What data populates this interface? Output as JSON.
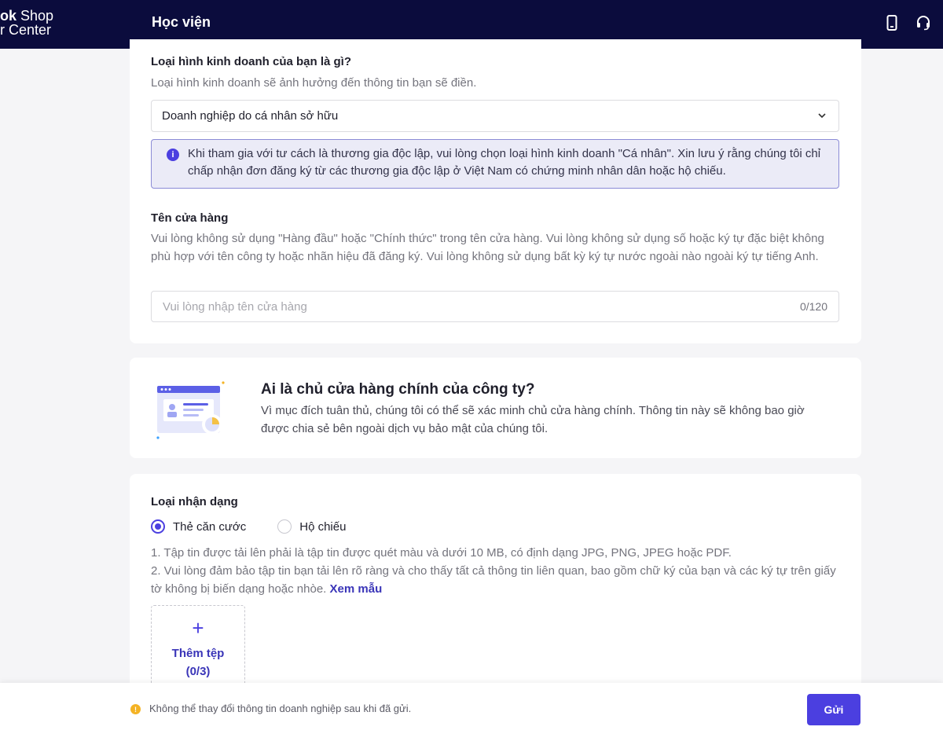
{
  "header": {
    "brand_line1_bold": "ok",
    "brand_line1_rest": " Shop",
    "brand_line2": "r Center",
    "page_title": "Học viện"
  },
  "business": {
    "label": "Loại hình kinh doanh của bạn là gì?",
    "help": "Loại hình kinh doanh sẽ ảnh hưởng đến thông tin bạn sẽ điền.",
    "selected": "Doanh nghiệp do cá nhân sở hữu",
    "info": "Khi tham gia với tư cách là thương gia độc lập, vui lòng chọn loại hình kinh doanh \"Cá nhân\". Xin lưu ý rằng chúng tôi chỉ chấp nhận đơn đăng ký từ các thương gia độc lập ở Việt Nam có chứng minh nhân dân hoặc hộ chiếu."
  },
  "store_name": {
    "label": "Tên cửa hàng",
    "help": "Vui lòng không sử dụng \"Hàng đầu\" hoặc \"Chính thức\" trong tên cửa hàng. Vui lòng không sử dụng số hoặc ký tự đặc biệt không phù hợp với tên công ty hoặc nhãn hiệu đã đăng ký. Vui lòng không sử dụng bất kỳ ký tự nước ngoài nào ngoài ký tự tiếng Anh.",
    "placeholder": "Vui lòng nhập tên cửa hàng",
    "value": "",
    "counter": "0/120"
  },
  "owner": {
    "title": "Ai là chủ cửa hàng chính của công ty?",
    "desc": "Vì mục đích tuân thủ, chúng tôi có thể sẽ xác minh chủ cửa hàng chính. Thông tin này sẽ không bao giờ được chia sẻ bên ngoài dịch vụ bảo mật của chúng tôi."
  },
  "identity": {
    "label": "Loại nhận dạng",
    "options": [
      "Thẻ căn cước",
      "Hộ chiếu"
    ],
    "selected_index": 0,
    "rule1": "1. Tập tin được tải lên phải là tập tin được quét màu và dưới 10 MB, có định dạng JPG, PNG, JPEG hoặc PDF.",
    "rule2": "2. Vui lòng đảm bảo tập tin bạn tải lên rõ ràng và cho thấy tất cả thông tin liên quan, bao gồm chữ ký của bạn và các ký tự trên giấy tờ không bị biến dạng hoặc nhòe.",
    "sample_link": "Xem mẫu",
    "upload_label": "Thêm tệp",
    "upload_count": "(0/3)"
  },
  "footer": {
    "note": "Không thể thay đổi thông tin doanh nghiệp sau khi đã gửi.",
    "submit": "Gửi"
  },
  "colors": {
    "header_bg": "#0b0c3d",
    "accent": "#4b3fe0",
    "warning": "#f4b324"
  }
}
